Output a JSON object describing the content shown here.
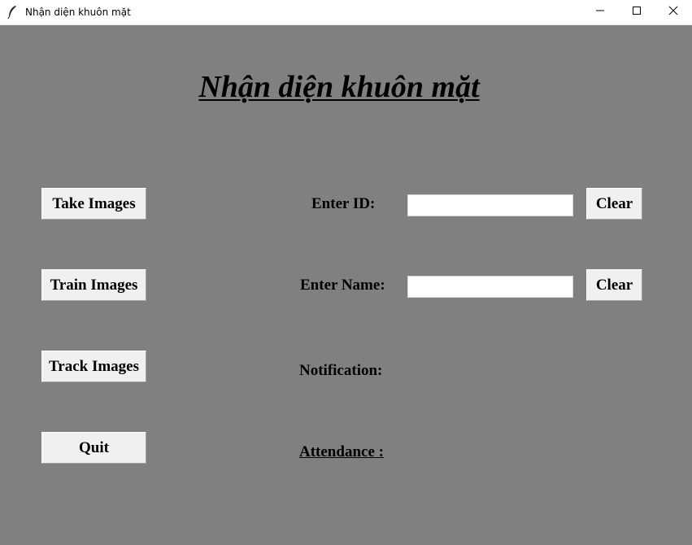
{
  "window": {
    "title": "Nhận diện khuôn mặt",
    "app_icon": "feather-icon",
    "controls": [
      "minimize-icon",
      "maximize-icon",
      "close-icon"
    ]
  },
  "heading": "Nhận diện khuôn mặt",
  "side_buttons": {
    "take_images": "Take Images",
    "train_images": "Train Images",
    "track_images": "Track Images",
    "quit": "Quit"
  },
  "form": {
    "id_label": "Enter ID:",
    "id_value": "",
    "name_label": "Enter Name:",
    "name_value": "",
    "clear_label": "Clear",
    "notification_label": "Notification:",
    "attendance_label": "Attendance : "
  },
  "colors": {
    "background": "#808080",
    "button_face": "#f0f0f0",
    "text": "#000000"
  }
}
